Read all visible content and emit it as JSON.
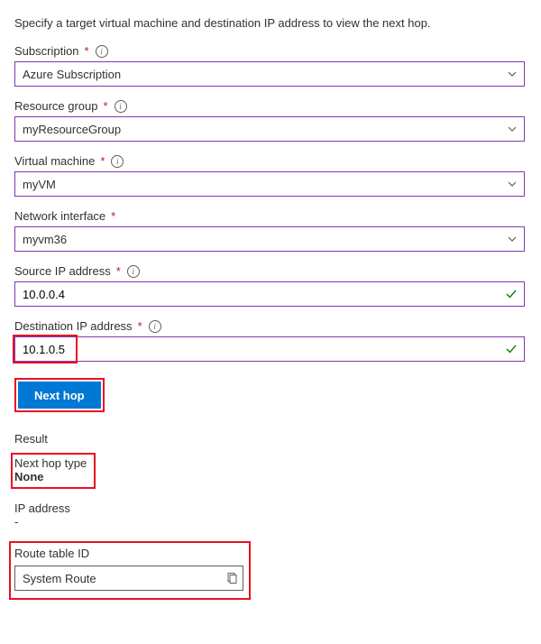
{
  "description": "Specify a target virtual machine and destination IP address to view the next hop.",
  "fields": {
    "subscription": {
      "label": "Subscription",
      "value": "Azure Subscription"
    },
    "resourceGroup": {
      "label": "Resource group",
      "value": "myResourceGroup"
    },
    "virtualMachine": {
      "label": "Virtual machine",
      "value": "myVM"
    },
    "networkInterface": {
      "label": "Network interface",
      "value": "myvm36"
    },
    "sourceIp": {
      "label": "Source IP address",
      "value": "10.0.0.4"
    },
    "destinationIp": {
      "label": "Destination IP address",
      "value": "10.1.0.5"
    }
  },
  "actions": {
    "nextHop": "Next hop"
  },
  "result": {
    "heading": "Result",
    "nextHopTypeLabel": "Next hop type",
    "nextHopTypeValue": "None",
    "ipAddressLabel": "IP address",
    "ipAddressValue": "-",
    "routeTableIdLabel": "Route table ID",
    "routeTableIdValue": "System Route"
  }
}
